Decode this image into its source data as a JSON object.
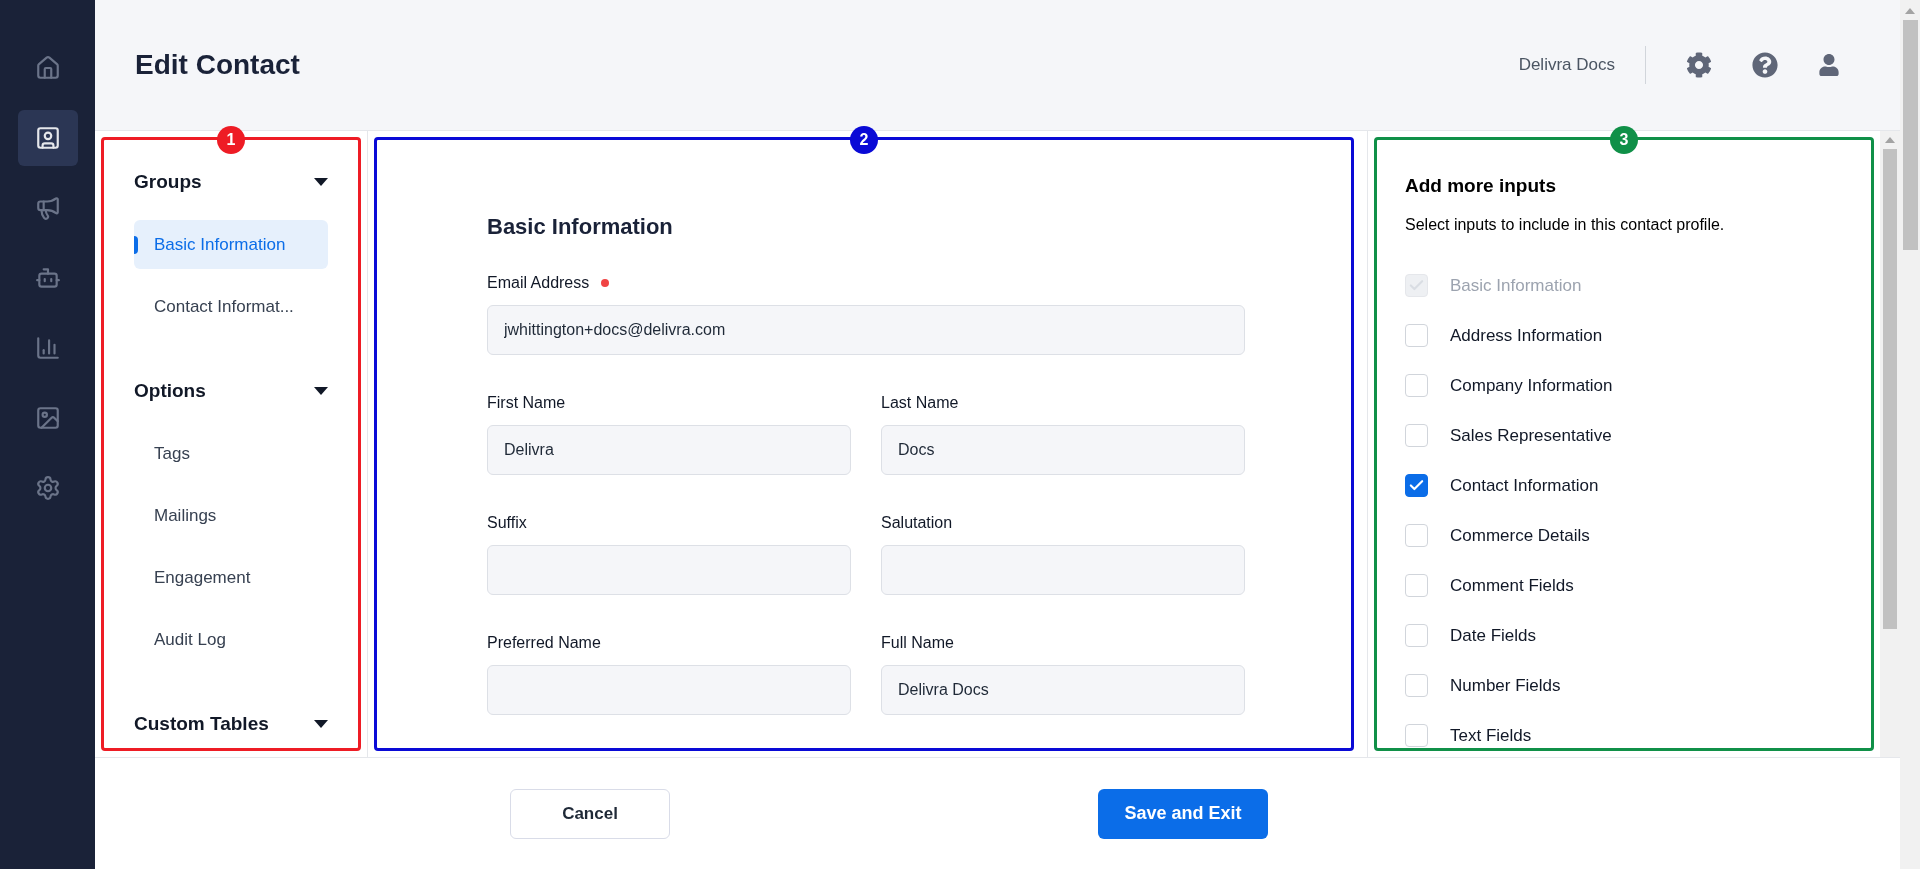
{
  "nav": [
    {
      "kind": "home",
      "selected": false
    },
    {
      "kind": "contacts",
      "selected": true
    },
    {
      "kind": "campaigns",
      "selected": false
    },
    {
      "kind": "automation",
      "selected": false
    },
    {
      "kind": "reports",
      "selected": false
    },
    {
      "kind": "images",
      "selected": false
    },
    {
      "kind": "settings",
      "selected": false
    }
  ],
  "header": {
    "title": "Edit Contact",
    "account": "Delivra Docs"
  },
  "groups_panel": {
    "callout": {
      "number": "1",
      "color": "#ee1c25"
    },
    "sections": [
      {
        "title": "Groups",
        "expanded": true,
        "items": [
          {
            "label": "Basic Information",
            "selected": true
          },
          {
            "label": "Contact Informat...",
            "selected": false
          }
        ]
      },
      {
        "title": "Options",
        "expanded": true,
        "items": [
          {
            "label": "Tags",
            "selected": false
          },
          {
            "label": "Mailings",
            "selected": false
          },
          {
            "label": "Engagement",
            "selected": false
          },
          {
            "label": "Audit Log",
            "selected": false
          }
        ]
      },
      {
        "title": "Custom Tables",
        "expanded": true
      }
    ]
  },
  "form": {
    "callout": {
      "number": "2",
      "color": "#0a0ad6"
    },
    "title": "Basic Information",
    "email": {
      "label": "Email Address",
      "required": true,
      "value": "jwhittington+docs@delivra.com"
    },
    "fields": [
      {
        "label": "First Name",
        "required": false,
        "value": "Delivra"
      },
      {
        "label": "Last Name",
        "required": false,
        "value": "Docs"
      },
      {
        "label": "Suffix",
        "required": false
      },
      {
        "label": "Salutation",
        "required": false
      },
      {
        "label": "Preferred Name",
        "required": false
      },
      {
        "label": "Full Name",
        "required": false,
        "value": "Delivra Docs"
      }
    ]
  },
  "inputs_panel": {
    "callout": {
      "number": "3",
      "color": "#109048"
    },
    "title": "Add more inputs",
    "description": "Select inputs to include in this contact profile.",
    "options": [
      {
        "label": "Basic Information",
        "checked": true,
        "disabled": true
      },
      {
        "label": "Address Information",
        "checked": false,
        "disabled": false
      },
      {
        "label": "Company Information",
        "checked": false,
        "disabled": false
      },
      {
        "label": "Sales Representative",
        "checked": false,
        "disabled": false
      },
      {
        "label": "Contact Information",
        "checked": true,
        "disabled": false
      },
      {
        "label": "Commerce Details",
        "checked": false,
        "disabled": false
      },
      {
        "label": "Comment Fields",
        "checked": false,
        "disabled": false
      },
      {
        "label": "Date Fields",
        "checked": false,
        "disabled": false
      },
      {
        "label": "Number Fields",
        "checked": false,
        "disabled": false
      },
      {
        "label": "Text Fields",
        "checked": false,
        "disabled": false
      }
    ]
  },
  "footer": {
    "cancel": "Cancel",
    "save": "Save and Exit"
  }
}
